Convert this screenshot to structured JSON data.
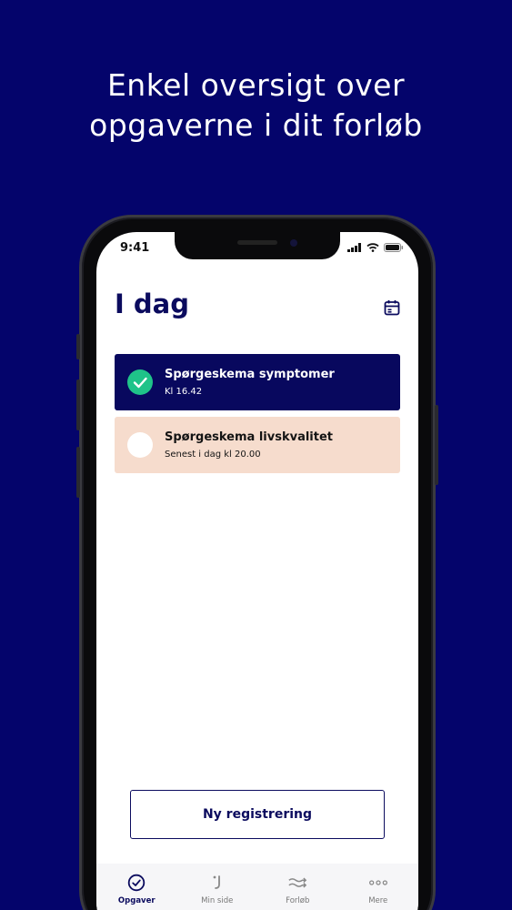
{
  "headline": {
    "line1": "Enkel oversigt over",
    "line2": "opgaverne i dit forløb"
  },
  "status_bar": {
    "time": "9:41"
  },
  "page": {
    "title": "I dag"
  },
  "tasks": [
    {
      "title": "Spørgeskema symptomer",
      "subtitle": "Kl 16.42",
      "completed": true
    },
    {
      "title": "Spørgeskema livskvalitet",
      "subtitle": "Senest i dag kl 20.00",
      "completed": false
    }
  ],
  "new_registration_label": "Ny registrering",
  "tabs": [
    {
      "label": "Opgaver",
      "icon": "check-circle-icon",
      "active": true
    },
    {
      "label": "Min side",
      "icon": "person-icon",
      "active": false
    },
    {
      "label": "Forløb",
      "icon": "arrows-icon",
      "active": false
    },
    {
      "label": "Mere",
      "icon": "more-dots-icon",
      "active": false
    }
  ],
  "colors": {
    "background": "#04046b",
    "brand_navy": "#0b0b5e",
    "success_green": "#1fc389",
    "pending_peach": "#f6dccd"
  }
}
